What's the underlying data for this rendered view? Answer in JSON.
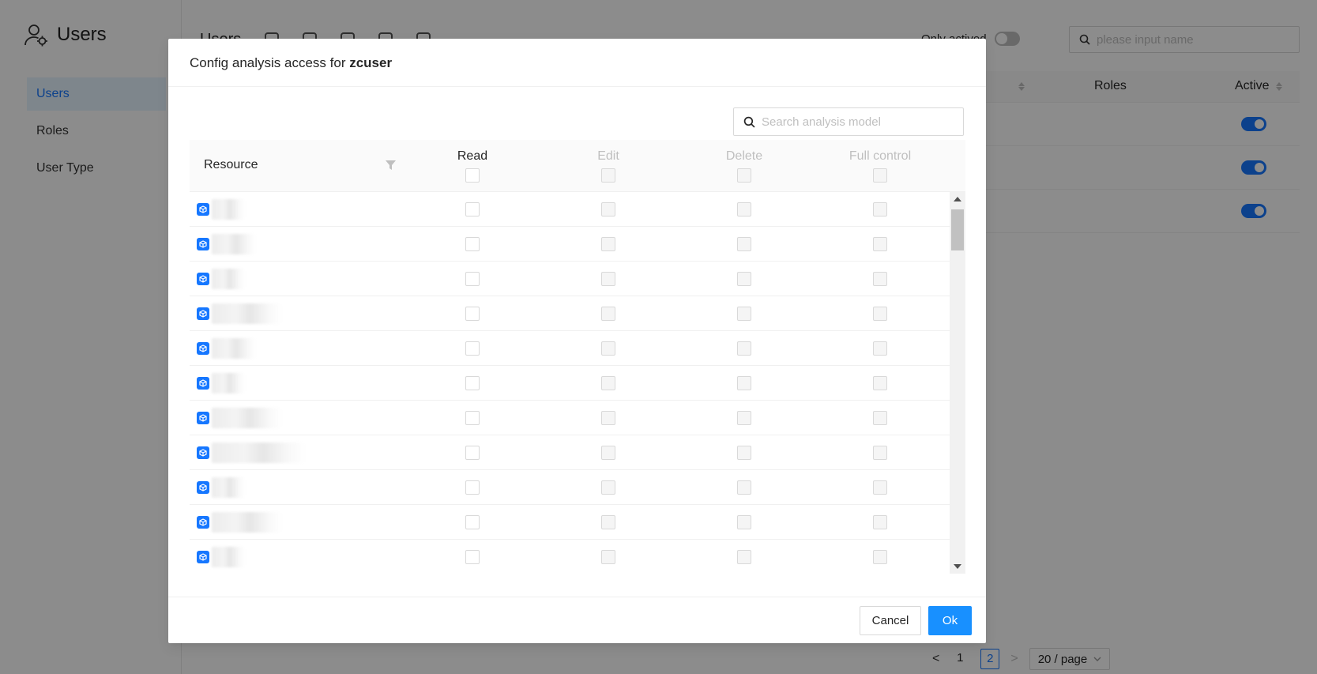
{
  "app": {
    "title": "Users",
    "nav": [
      {
        "label": "Users",
        "active": true
      },
      {
        "label": "Roles",
        "active": false
      },
      {
        "label": "User Type",
        "active": false
      }
    ],
    "toolbar_title": "Users",
    "only_actived_label": "Only actived",
    "search_placeholder": "please input name",
    "table_headers": {
      "roles": "Roles",
      "active": "Active"
    },
    "rows_active": [
      true,
      true,
      true
    ],
    "pagination": {
      "prev": "<",
      "pages": [
        "1",
        "2"
      ],
      "current": "2",
      "next": ">",
      "page_size": "20 / page"
    }
  },
  "modal": {
    "title_prefix": "Config analysis access for",
    "user": "zcuser",
    "search_placeholder": "Search analysis model",
    "columns": {
      "resource": "Resource",
      "read": "Read",
      "edit": "Edit",
      "delete": "Delete",
      "full_control": "Full control"
    },
    "row_count": 11,
    "cancel_label": "Cancel",
    "ok_label": "Ok"
  },
  "colors": {
    "primary": "#1890ff",
    "mask": "rgba(0,0,0,0.45)"
  },
  "icons": [
    "user-settings-icon",
    "search-icon",
    "filter-icon",
    "cube-icon",
    "sort-icon"
  ]
}
